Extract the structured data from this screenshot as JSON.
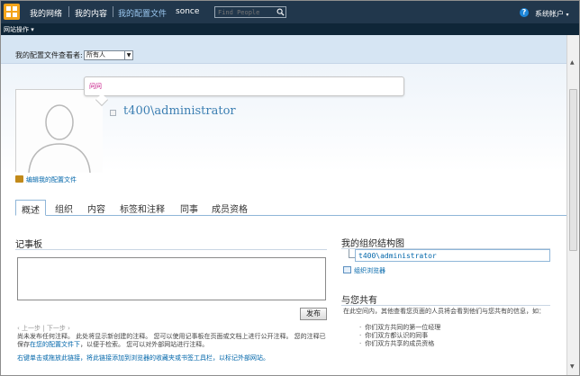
{
  "topbar": {
    "nav": [
      "我的网络",
      "我的内容",
      "我的配置文件",
      "sonce"
    ],
    "search_placeholder": "Find People",
    "account_label": "系统帐户",
    "account_arrow": "▾"
  },
  "sitebar": {
    "site_actions": "网站操作 ▾"
  },
  "viewer": {
    "label": "我的配置文件查看者:",
    "selected": "所有人"
  },
  "profile": {
    "status": "问问",
    "user_name": "t400\\administrator",
    "edit_link": "编辑我的配置文件"
  },
  "tabs": [
    "概述",
    "组织",
    "内容",
    "标签和注释",
    "同事",
    "成员资格"
  ],
  "noteboard": {
    "title": "记事板",
    "post_label": "发布",
    "prev": "‹ 上一步",
    "divider": "|",
    "next": "下一步 ›",
    "desc_before": "尚未发布任何注释。 此处将显示新创建的注释。 您可以使用记事板在页面或文档上进行公开注释。 您的注释已保存",
    "desc_link": "在您的配置文件下",
    "desc_after": "，以便于检索。 您可以对外部网站进行注释。",
    "bookmarklet": "右键单击或拖放此链接，将此链接添加到浏览器的收藏夹或书签工具栏，以标记外部网站。"
  },
  "org": {
    "title": "我的组织结构图",
    "name": "t400\\administrator",
    "browser_link": "组织浏览器"
  },
  "common": {
    "title": "与您共有",
    "desc": "在此空间内，其他查看您页面的人员将会看到他们与您共有的信息，如：",
    "items": [
      "你们双方共同的第一位经理",
      "你们双方都认识的同事",
      "你们双方共享的成员资格"
    ]
  },
  "colors": {
    "topbar": "#21374c",
    "link": "#0066aa",
    "name": "#3c7fb2",
    "status": "#c0007a",
    "accent": "#f3a41b"
  }
}
